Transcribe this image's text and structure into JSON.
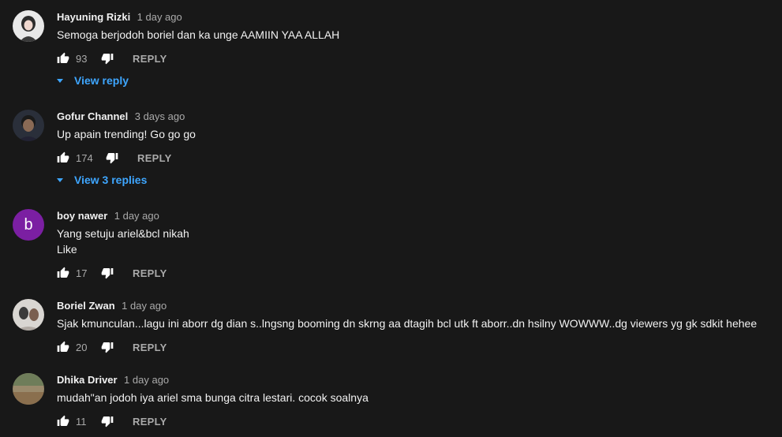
{
  "comments": [
    {
      "author": "Hayuning Rizki",
      "time": "1 day ago",
      "text": [
        "Semoga berjodoh boriel dan ka unge AAMIIN YAA ALLAH"
      ],
      "likes": "93",
      "reply_label": "REPLY",
      "view_replies": "View reply"
    },
    {
      "author": "Gofur Channel",
      "time": "3 days ago",
      "text": [
        "Up apain trending! Go go go"
      ],
      "likes": "174",
      "reply_label": "REPLY",
      "view_replies": "View 3 replies"
    },
    {
      "author": "boy nawer",
      "time": "1 day ago",
      "avatar_letter": "b",
      "avatar_color": "#7b1fa2",
      "text": [
        "Yang setuju ariel&bcl nikah",
        "Like"
      ],
      "likes": "17",
      "reply_label": "REPLY"
    },
    {
      "author": "Boriel Zwan",
      "time": "1 day ago",
      "text": [
        "Sjak kmunculan...lagu ini aborr dg dian s..lngsng booming dn skrng aa dtagih bcl utk ft aborr..dn hsilny WOWWW..dg viewers yg gk sdkit hehee"
      ],
      "likes": "20",
      "reply_label": "REPLY"
    },
    {
      "author": "Dhika Driver",
      "time": "1 day ago",
      "text": [
        "mudah\"an jodoh iya ariel sma bunga citra lestari. cocok soalnya"
      ],
      "likes": "11",
      "reply_label": "REPLY"
    }
  ],
  "colors": {
    "background": "#181818",
    "link": "#3ea6ff",
    "muted": "#aaaaaa"
  }
}
